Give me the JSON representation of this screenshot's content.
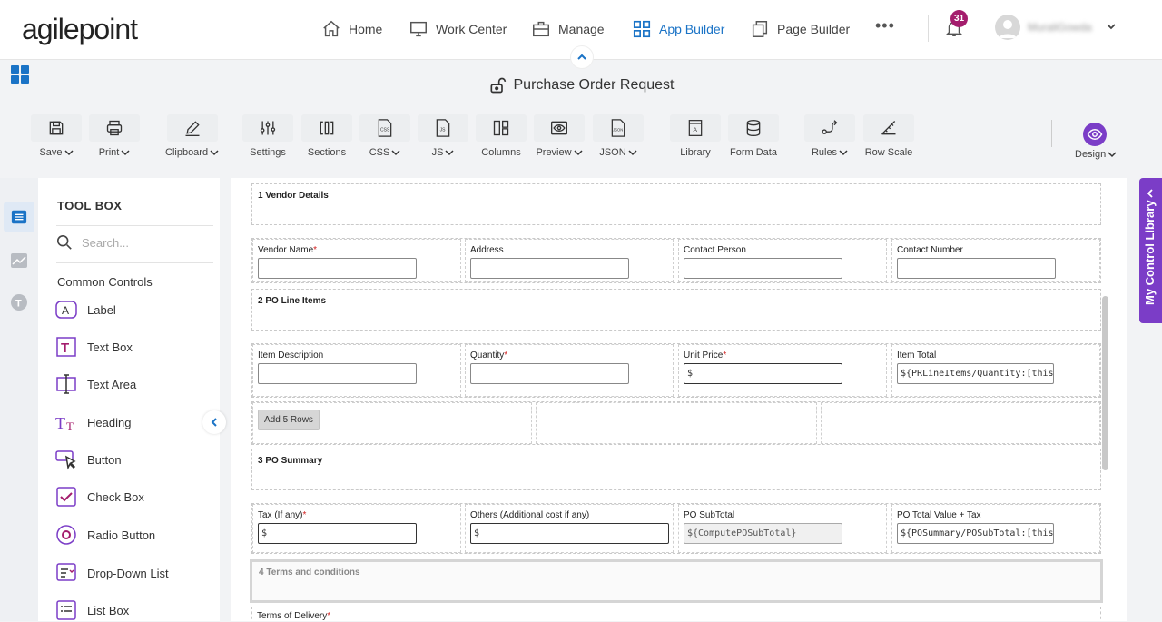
{
  "brand": {
    "logo_text": "agilepoint"
  },
  "nav": {
    "items": [
      {
        "label": "Home",
        "icon": "home-icon"
      },
      {
        "label": "Work Center",
        "icon": "monitor-icon"
      },
      {
        "label": "Manage",
        "icon": "briefcase-icon"
      },
      {
        "label": "App Builder",
        "icon": "grid-icon",
        "active": true
      },
      {
        "label": "Page Builder",
        "icon": "pages-icon"
      }
    ],
    "more": "•••",
    "notifications_count": "31",
    "username": "MuraliGowda"
  },
  "page": {
    "title": "Purchase Order Request"
  },
  "toolbar": {
    "save": "Save",
    "print": "Print",
    "clipboard": "Clipboard",
    "settings": "Settings",
    "sections": "Sections",
    "css": "CSS",
    "js": "JS",
    "columns": "Columns",
    "preview": "Preview",
    "json": "JSON",
    "library": "Library",
    "form_data": "Form Data",
    "rules": "Rules",
    "row_scale": "Row Scale",
    "design": "Design"
  },
  "toolbox": {
    "title": "TOOL BOX",
    "search_placeholder": "Search...",
    "section": "Common Controls",
    "items": [
      "Label",
      "Text Box",
      "Text Area",
      "Heading",
      "Button",
      "Check Box",
      "Radio Button",
      "Drop-Down List",
      "List Box"
    ]
  },
  "form": {
    "sections": {
      "s1": "1 Vendor Details",
      "s2": "2 PO Line Items",
      "s3": "3 PO Summary",
      "s4": "4 Terms and conditions"
    },
    "vendor": {
      "name": "Vendor Name",
      "address": "Address",
      "contact_person": "Contact Person",
      "contact_number": "Contact Number"
    },
    "line": {
      "item_description": "Item Description",
      "quantity": "Quantity",
      "unit_price": "Unit Price",
      "unit_price_value": "$",
      "item_total": "Item Total",
      "item_total_value": "${PRLineItems/Quantity:[this]} * ${P"
    },
    "add_rows": "Add 5 Rows",
    "summary": {
      "tax": "Tax (If any)",
      "tax_value": "$",
      "others": "Others (Additional cost if any)",
      "others_value": "$",
      "subtotal": "PO SubTotal",
      "subtotal_value": "${ComputePOSubTotal}",
      "total": "PO Total Value + Tax",
      "total_value": "${POSummary/POSubTotal:[this]} +$"
    },
    "terms_delivery": "Terms of Delivery",
    "required_mark": "*"
  },
  "side_panel": {
    "label": "My Control Library"
  },
  "colors": {
    "accent": "#7b3dc7",
    "nav_active": "#1a73c6",
    "badge": "#a41d6d",
    "required": "#d01f1f"
  }
}
